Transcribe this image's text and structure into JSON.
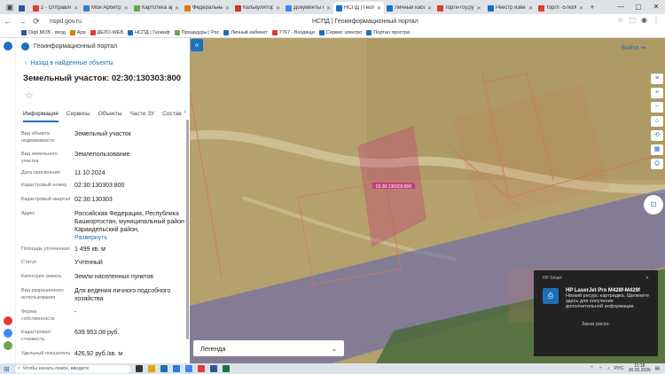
{
  "browser": {
    "tabs": [
      {
        "label": "",
        "color": "#2b5797",
        "active": false
      },
      {
        "label": "2 - Отправлен:",
        "color": "#e03c31",
        "active": false
      },
      {
        "label": "Мой Арбитр",
        "color": "#3b7bbf",
        "active": false
      },
      {
        "label": "Картотека арб",
        "color": "#6aa84f",
        "active": false
      },
      {
        "label": "Федеральны:",
        "color": "#e07b00",
        "active": false
      },
      {
        "label": "Калькулятор гр",
        "color": "#c0392b",
        "active": false
      },
      {
        "label": "Документы кс",
        "color": "#4285f4",
        "active": false
      },
      {
        "label": "НСПД | Геоп:",
        "color": "#1b6fbd",
        "active": true
      },
      {
        "label": "Личный кабин:",
        "color": "#1b6fbd",
        "active": false
      },
      {
        "label": "торги-гоу.ру",
        "color": "#e03c31",
        "active": false
      },
      {
        "label": "Реестр извещ:",
        "color": "#1b6fbd",
        "active": false
      },
      {
        "label": "торгп -57ю0О",
        "color": "#e03c31",
        "active": false
      }
    ],
    "url": "nspd.gov.ru",
    "page_title": "НСПД | Геоинформационный портал",
    "bookmarks": [
      "Digit МОВ - вход",
      "App",
      "ДЕЛО-WEB",
      "НСПД | Геоинф",
      "Процедуры | Рос",
      "Личный кабинет",
      "7767 - Входящи",
      "Сервис электро",
      "Портал простра"
    ]
  },
  "sidebar": {
    "portal_name": "Геоинформационный портал",
    "back_label": "Назад в найденные объекты",
    "title": "Земельный участок: 02:30:130303:800",
    "tabs": [
      "Информация",
      "Сервисы",
      "Объекты",
      "Части ЗУ",
      "Состав"
    ],
    "rows": [
      {
        "label": "Вид объекта недвижимости",
        "value": "Земельный участок"
      },
      {
        "label": "Вид земельного участка",
        "value": "Землепользование"
      },
      {
        "label": "Дата присвоения",
        "value": "11.10.2024"
      },
      {
        "label": "Кадастровый номер",
        "value": "02:30:130303:800"
      },
      {
        "label": "Кадастровый квартал",
        "value": "02:30:130303"
      },
      {
        "label": "Адрес",
        "value": "Российская Федерация, Республика Башкортостан, муниципальный район Караидельский район,",
        "link": "Развернуть"
      },
      {
        "label": "Площадь уточненная",
        "value": "1 499 кв. м"
      },
      {
        "label": "Статус",
        "value": "Учтенный"
      },
      {
        "label": "Категория земель",
        "value": "Земли населенных пунктов"
      },
      {
        "label": "Вид разрешенного использования",
        "value": "Для ведения личного подсобного хозяйства"
      },
      {
        "label": "Форма собственности",
        "value": "-"
      },
      {
        "label": "Кадастровая стоимость",
        "value": "639 953,08 руб."
      },
      {
        "label": "Удельный показатель",
        "value": "426,92 руб./кв. м"
      }
    ]
  },
  "map": {
    "login_label": "Войти",
    "legend_label": "Легенда",
    "parcel_label": "02:30:130303:800",
    "buttons": [
      "≡",
      "+",
      "−",
      "⌂",
      "⟲",
      "▦",
      "⎙"
    ]
  },
  "notification": {
    "app": "HP Smart",
    "title": "HP LaserJet Pro M428f-M429f",
    "body": "Низкий ресурс картриджа. Щелкните здесь для получения дополнительной информации.",
    "button": "Заказ расхн."
  },
  "taskbar": {
    "search_placeholder": "Чтобы начать поиск, введите",
    "lang": "РУС",
    "time": "11:18",
    "date": "30.05.2026"
  }
}
